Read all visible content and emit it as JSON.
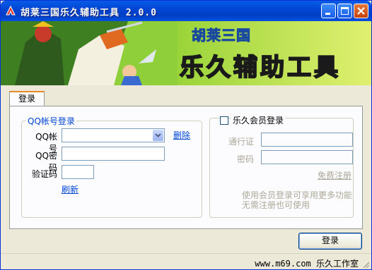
{
  "window": {
    "title": "胡莱三国乐久辅助工具 2.0.0"
  },
  "banner": {
    "subtitle": "胡莱三国",
    "title": "乐久辅助工具"
  },
  "tabs": [
    {
      "label": "登录"
    }
  ],
  "qq_login": {
    "group_title": "QQ帐号登录",
    "account_label": "QQ帐号",
    "account_value": "",
    "delete_link": "删除",
    "password_label": "QQ密码",
    "captcha_label": "验证码",
    "refresh_link": "刷新"
  },
  "member_login": {
    "checkbox_label": "乐久会员登录",
    "checked": false,
    "pass_label": "通行证",
    "password_label": "密码",
    "register_link": "免费注册",
    "note_line1": "使用会员登录可享用更多功能",
    "note_line2": "无需注册也可使用"
  },
  "actions": {
    "login_button": "登录"
  },
  "footer": {
    "text": "www.m69.com 乐久工作室"
  },
  "colors": {
    "titlebar": "#0046d5",
    "link": "#0046d5",
    "window_bg": "#ece9d8"
  }
}
